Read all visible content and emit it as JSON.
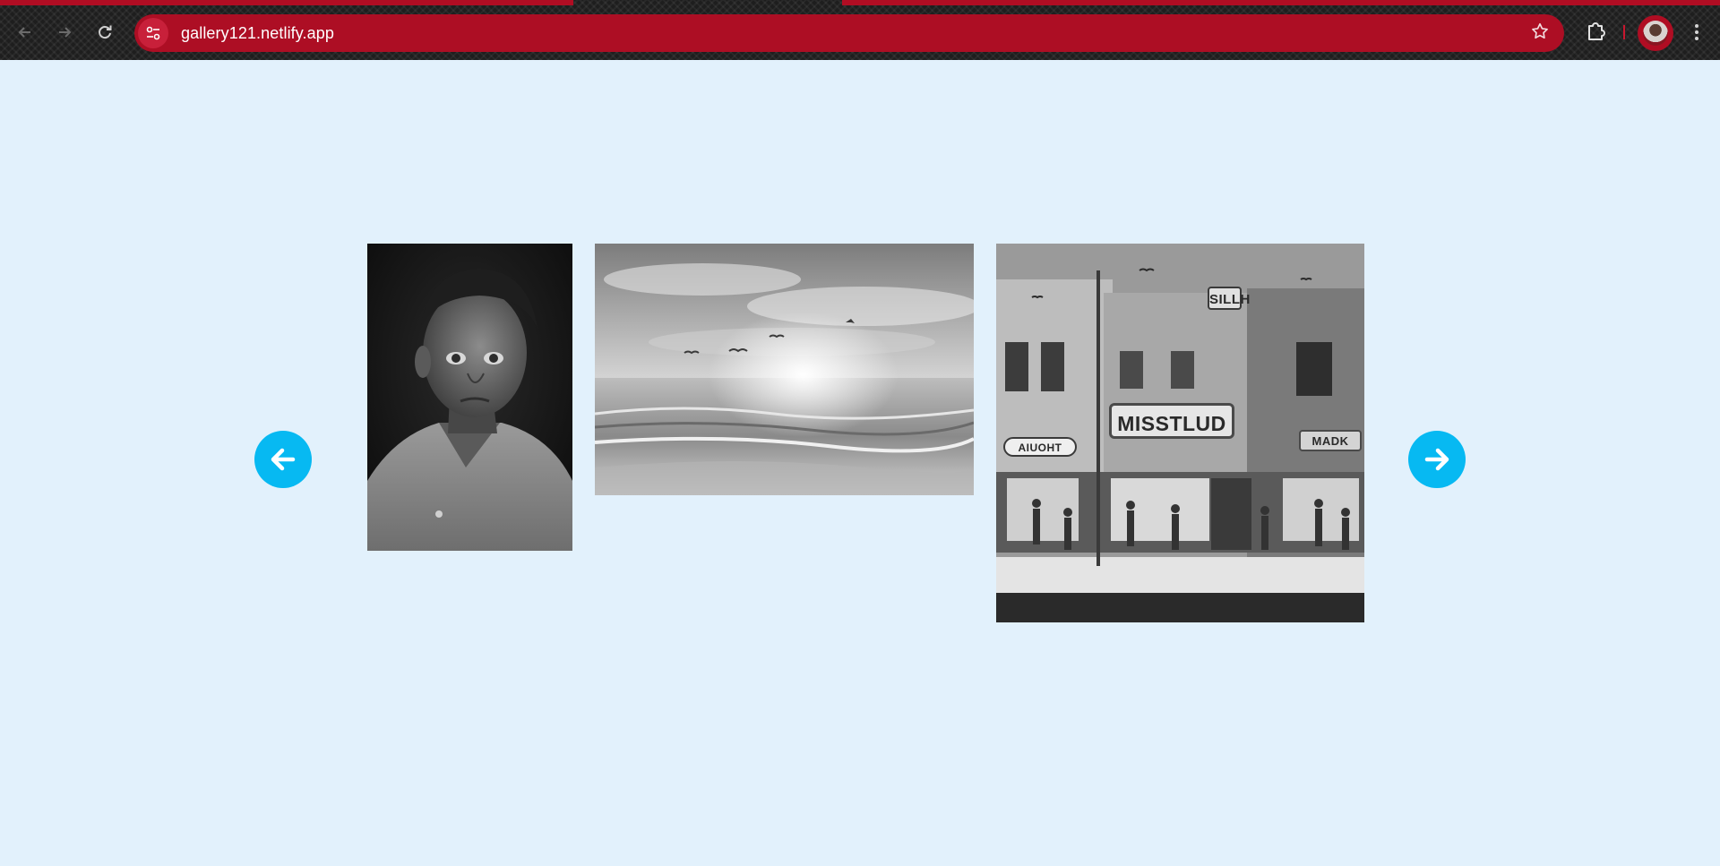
{
  "browser": {
    "url": "gallery121.netlify.app",
    "accent_color": "#ad0e24",
    "icons": {
      "back": "arrow-left-icon",
      "forward": "arrow-right-icon",
      "reload": "reload-icon",
      "site_info": "tune-icon",
      "bookmark": "star-icon",
      "extensions": "puzzle-icon",
      "menu": "kebab-menu-icon"
    }
  },
  "gallery": {
    "background": "#e2f1fc",
    "arrow_color": "#07b9f2",
    "prev_icon": "arrow-left-icon",
    "next_icon": "arrow-right-icon",
    "photos": [
      {
        "subject": "boy-portrait"
      },
      {
        "subject": "beach-sunset"
      },
      {
        "subject": "street-storefronts"
      }
    ],
    "street_signs": {
      "main": "MISSTLUD",
      "top": "SILLH",
      "left": "AIUOHT",
      "right": "MADK"
    }
  }
}
